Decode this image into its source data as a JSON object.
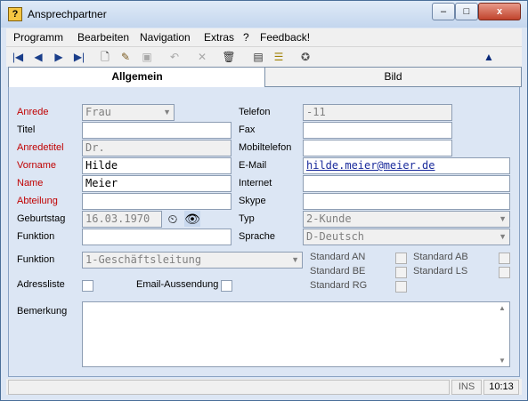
{
  "window": {
    "title": "Ansprechpartner",
    "minimize": "–",
    "maximize": "□",
    "close": "x"
  },
  "menu": [
    "Programm",
    "Bearbeiten",
    "Navigation",
    "Extras",
    "?",
    "Feedback!"
  ],
  "toolbar": {
    "icons": [
      "first-record-icon",
      "prev-record-icon",
      "next-record-icon",
      "last-record-icon",
      "new-record-icon",
      "edit-icon",
      "save-icon",
      "undo-icon",
      "cancel-icon",
      "delete-icon",
      "print-icon",
      "list-icon",
      "settings-icon",
      "up-arrow-icon"
    ]
  },
  "tabs": {
    "general": "Allgemein",
    "picture": "Bild"
  },
  "form": {
    "anrede": {
      "label": "Anrede",
      "value": "Frau"
    },
    "titel": {
      "label": "Titel",
      "value": ""
    },
    "anredetitel": {
      "label": "Anredetitel",
      "value": "Dr."
    },
    "vorname": {
      "label": "Vorname",
      "value": "Hilde"
    },
    "name": {
      "label": "Name",
      "value": "Meier"
    },
    "abteilung": {
      "label": "Abteilung",
      "value": ""
    },
    "geburtstag": {
      "label": "Geburtstag",
      "value": "16.03.1970"
    },
    "funktion_text": {
      "label": "Funktion",
      "value": ""
    },
    "telefon": {
      "label": "Telefon",
      "value": "-11"
    },
    "fax": {
      "label": "Fax",
      "value": ""
    },
    "mobil": {
      "label": "Mobiltelefon",
      "value": ""
    },
    "email": {
      "label": "E-Mail",
      "value": "hilde.meier@meier.de"
    },
    "internet": {
      "label": "Internet",
      "value": ""
    },
    "skype": {
      "label": "Skype",
      "value": ""
    },
    "typ": {
      "label": "Typ",
      "value": "2-Kunde"
    },
    "sprache": {
      "label": "Sprache",
      "value": "D-Deutsch"
    },
    "funktion_combo": {
      "label": "Funktion",
      "value": "1-Geschäftsleitung"
    },
    "adressliste": {
      "label": "Adressliste",
      "checked": false
    },
    "email_aussendung": {
      "label": "Email-Aussendung",
      "checked": false
    },
    "standard_an": {
      "label": "Standard AN",
      "checked": false
    },
    "standard_ab": {
      "label": "Standard AB",
      "checked": false
    },
    "standard_be": {
      "label": "Standard BE",
      "checked": false
    },
    "standard_ls": {
      "label": "Standard LS",
      "checked": false
    },
    "standard_rg": {
      "label": "Standard RG",
      "checked": false
    },
    "bemerkung": {
      "label": "Bemerkung",
      "value": ""
    }
  },
  "status": {
    "mode": "INS",
    "time": "10:13"
  },
  "colors": {
    "required_label": "#c00000",
    "link": "#1a2b9c"
  }
}
